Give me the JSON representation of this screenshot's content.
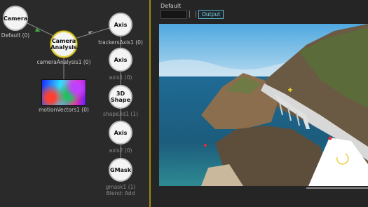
{
  "nodes": {
    "camera": {
      "title": "Camera",
      "caption": "Default (0)"
    },
    "camera_analysis": {
      "title": "Camera\nAnalysis",
      "caption": "cameraAnalysis1 (0)"
    },
    "motion_vectors": {
      "caption": "motionVectors1 (0)"
    },
    "axis_trackers": {
      "title": "Axis",
      "caption": "trackersAxis1 (0)"
    },
    "axis_1": {
      "title": "Axis",
      "caption": "axis1 (0)"
    },
    "shape_3d": {
      "title": "3D\nShape",
      "caption": "shape3d1 (1)"
    },
    "axis_2": {
      "title": "Axis",
      "caption": "axis2 (0)"
    },
    "gmask": {
      "title": "GMask",
      "caption": "gmask1 (1)",
      "caption2": "Blend: Add"
    }
  },
  "viewer": {
    "title": "Default",
    "output_button": "Output"
  },
  "colors": {
    "selected_border": "#e6d23a",
    "edge_color": "#8a8a8a",
    "arrow_green": "#3fb03f",
    "output_accent": "#5ab0c8"
  }
}
